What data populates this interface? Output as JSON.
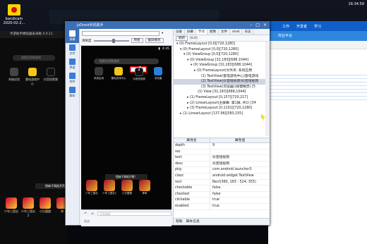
{
  "desktop": {
    "icon_label": "bandicam\n2020-02-2...",
    "top_right_time": "16:34:59",
    "bg_emulator_title": "手游助手模拟器安卓版 4.0.11",
    "bg_search_placeholder": "搜索应用和游戏",
    "bg_apps": [
      "系统应用",
      "雷电游戏中心",
      "抖音短视频",
      "浏览器"
    ],
    "bg_games": [
      "少年三国志",
      "少年三国志2",
      "小白盟盟",
      "海"
    ],
    "bg_banner": "找妹子高抵开黑！"
  },
  "right_panel": {
    "tabs_blue": [
      "工作",
      "开发者",
      "学习"
    ],
    "header": "商业平台"
  },
  "window": {
    "title": "JsDroid手机助手",
    "device_select": "",
    "clarity_label": "清晰度",
    "btn_original": "原图",
    "btn_screenshot": "截屏模式",
    "side_items": [
      "屏幕",
      "文件",
      "界面",
      "控件",
      "脚本"
    ]
  },
  "phone": {
    "time": "4:35",
    "search_placeholder": "搜索应用和游戏",
    "apps": [
      "系统应用",
      "雷电游戏中心",
      "抖音短视频",
      "浏览器"
    ],
    "banner": "找妹子高抵开黑！",
    "games": [
      "少年三国志",
      "少年三国志2",
      "小白盟盟",
      "神奇"
    ],
    "input_placeholder": "打开网页",
    "footer_text": "发送"
  },
  "inspector": {
    "tabs": [
      "设备",
      "屏幕",
      "节点",
      "图像",
      "文件",
      "shell",
      "日志"
    ],
    "active_tab": "节点",
    "tools": [
      "刷新",
      "[0,0]"
    ],
    "tree": [
      "▾ (0) FrameLayout [0,0][720,1280]",
      "▾ (0) FrameLayout [0,0][720,1280]",
      "▾ (0) ViewGroup [0,0][720,1280]",
      "▾ (0) ViewGroup [32,183][688,1044]",
      "▾ (0) ViewGroup [32,183][688,1044]",
      "▸ (0) FrameLayout(文件夹: 系统应用",
      "(1) TextView(雷电游戏中心)雷电游戏",
      "(2) TextView(抖音短视频)抖音短视频",
      "(3) TextView(浏览器)(按键精灵) [5",
      "(1) View [32,183][688,1044]",
      "▸ (1) FrameLayout [0,157][720,217]",
      "▸ (2) LinearLayout(主屏幕: 第1屏, 共1) [34",
      "▸ (3) FrameLayout [0,1101][720,1280]",
      "▸ (1) LinearLayout [137,96][583,155]"
    ],
    "highlight_index": 7,
    "props_header": [
      "属性名",
      "属性值"
    ],
    "props": [
      [
        "depth",
        "9"
      ],
      [
        "res",
        ""
      ],
      [
        "text",
        "抖音短视频"
      ],
      [
        "desc",
        "抖音短视频"
      ],
      [
        "pkg",
        "com.android.launcher3"
      ],
      [
        "clazz",
        "android.widget.TextView"
      ],
      [
        "rect",
        "Rect(360, 183 - 524, 355)"
      ],
      [
        "checkable",
        "false"
      ],
      [
        "checked",
        "false"
      ],
      [
        "clickable",
        "true"
      ],
      [
        "enabled",
        "true"
      ]
    ],
    "footer": [
      "帮助",
      "脚本信息"
    ]
  }
}
